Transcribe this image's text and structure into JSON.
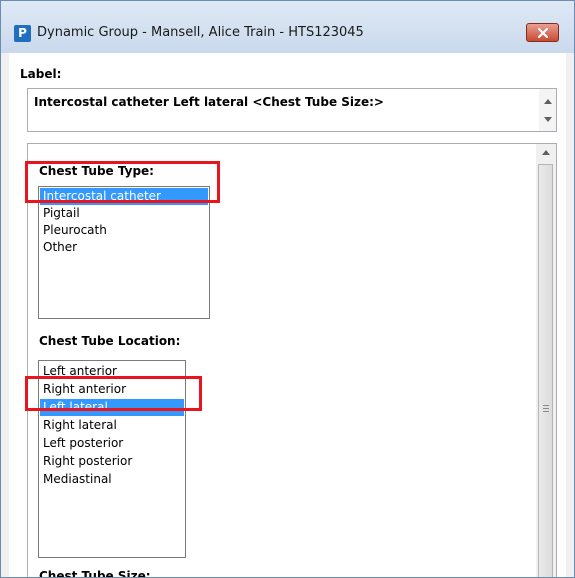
{
  "window": {
    "title": "Dynamic Group - Mansell, Alice Train - HTS123045",
    "app_icon_letter": "P",
    "close_icon": "close-x-icon"
  },
  "label_field": {
    "heading": "Label:",
    "value": "Intercostal catheter Left lateral <Chest Tube Size:>"
  },
  "sections": {
    "chest_tube_type": {
      "label": "Chest Tube Type:",
      "options": [
        "Intercostal catheter",
        "Pigtail",
        "Pleurocath",
        "Other"
      ],
      "selected": "Intercostal catheter"
    },
    "chest_tube_location": {
      "label": "Chest Tube Location:",
      "options": [
        "Left anterior",
        "Right anterior",
        "Left lateral",
        "Right lateral",
        "Left posterior",
        "Right posterior",
        "Mediastinal"
      ],
      "selected": "Left lateral"
    },
    "chest_tube_size": {
      "label": "Chest Tube Size:"
    }
  },
  "colors": {
    "selection": "#3399ff",
    "highlight_box": "#e8141e"
  }
}
